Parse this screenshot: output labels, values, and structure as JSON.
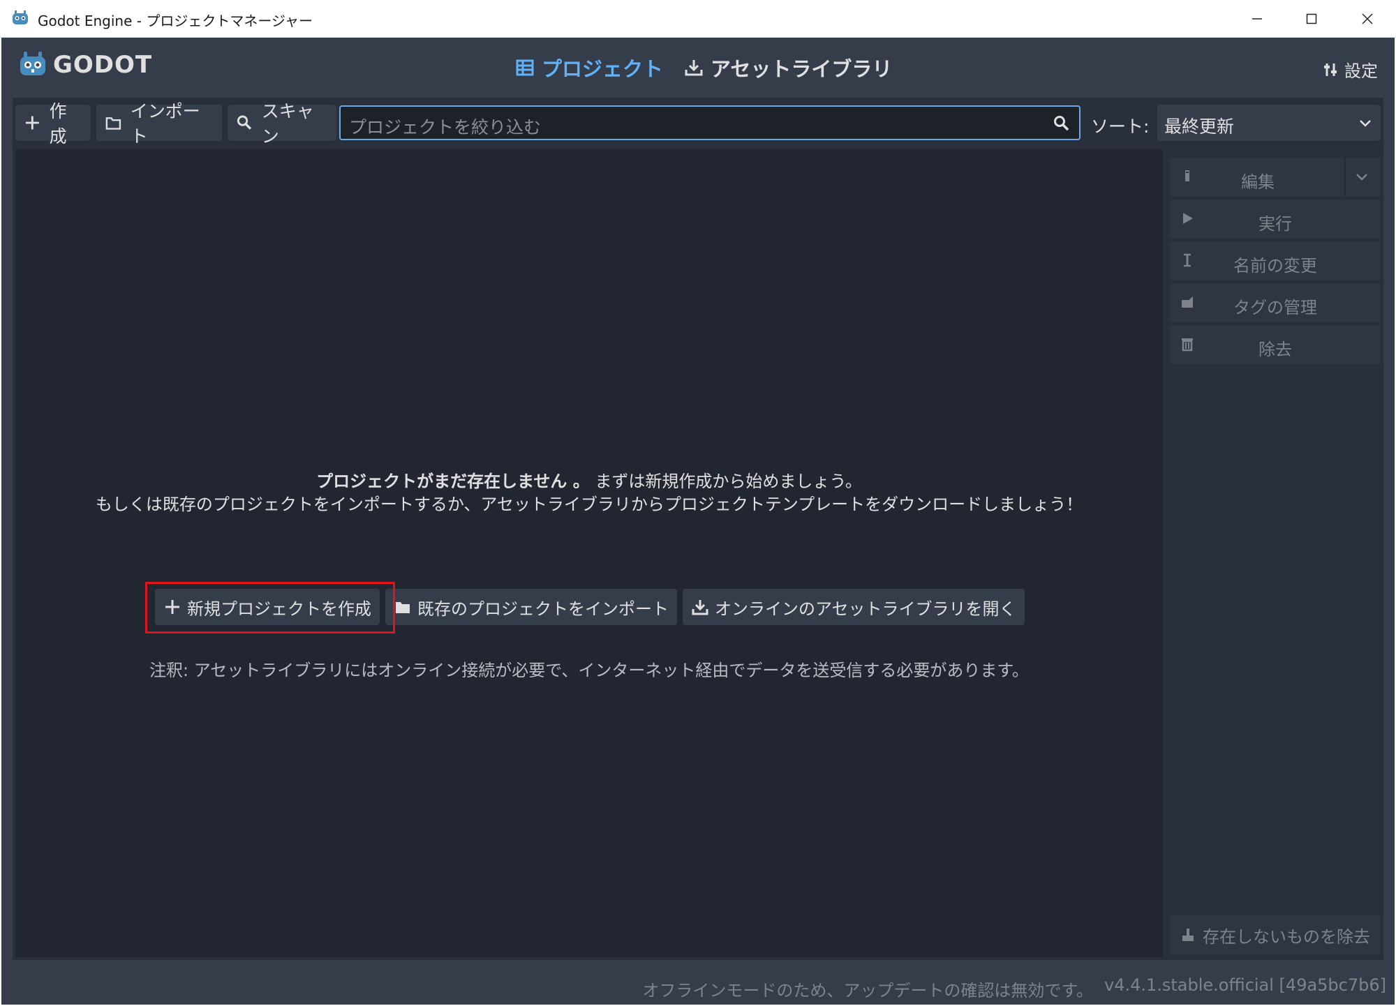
{
  "window": {
    "title": "Godot Engine - プロジェクトマネージャー",
    "icon": "godot-icon"
  },
  "header": {
    "logo_text": "GODOT",
    "tabs": [
      {
        "label": "プロジェクト",
        "icon": "project-list-icon",
        "active": true
      },
      {
        "label": "アセットライブラリ",
        "icon": "download-icon",
        "active": false
      }
    ],
    "settings_label": "設定"
  },
  "toolbar": {
    "create_label": "作成",
    "import_label": "インポート",
    "scan_label": "スキャン",
    "search_placeholder": "プロジェクトを絞り込む",
    "sort_label": "ソート:",
    "sort_value": "最終更新"
  },
  "empty_state": {
    "title_bold": "プロジェクトがまだ存在しません 。",
    "title_rest": "まずは新規作成から始めましょう。",
    "line2": "もしくは既存のプロジェクトをインポートするか、アセットライブラリからプロジェクトテンプレートをダウンロードしましょう！",
    "btn_new": "新規プロジェクトを作成",
    "btn_import": "既存のプロジェクトをインポート",
    "btn_asset": "オンラインのアセットライブラリを開く",
    "note": "注釈: アセットライブラリにはオンライン接続が必要で、インターネット経由でデータを送受信する必要があります。"
  },
  "side_panel": {
    "edit": "編集",
    "run": "実行",
    "rename": "名前の変更",
    "manage_tags": "タグの管理",
    "remove": "除去",
    "remove_missing": "存在しないものを除去"
  },
  "status": {
    "offline_text": "オフラインモードのため、アップデートの確認は無効です。",
    "version": "v4.4.1.stable.official [49a5bc7b6]"
  },
  "colors": {
    "accent": "#5fb2f7",
    "highlight": "#e0141b"
  }
}
